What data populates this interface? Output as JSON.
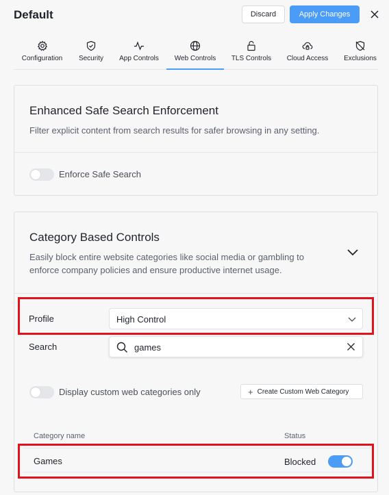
{
  "header": {
    "title": "Default",
    "discard_label": "Discard",
    "apply_label": "Apply Changes"
  },
  "tabs": [
    {
      "label": "Configuration",
      "icon": "gear-icon"
    },
    {
      "label": "Security",
      "icon": "shield-icon"
    },
    {
      "label": "App Controls",
      "icon": "activity-icon"
    },
    {
      "label": "Web Controls",
      "icon": "globe-icon",
      "active": true
    },
    {
      "label": "TLS Controls",
      "icon": "lock-icon"
    },
    {
      "label": "Cloud Access",
      "icon": "cloud-lock-icon"
    },
    {
      "label": "Exclusions",
      "icon": "shield-off-icon"
    }
  ],
  "safe_search": {
    "title": "Enhanced Safe Search Enforcement",
    "description": "Filter explicit content from search results for safer browsing in any setting.",
    "toggle_label": "Enforce Safe Search",
    "enabled": false
  },
  "category": {
    "title": "Category Based Controls",
    "description_line1": "Easily block entire website categories like social media or gambling to",
    "description_line2": "enforce company policies and ensure productive internet usage.",
    "profile_label": "Profile",
    "profile_value": "High Control",
    "search_label": "Search",
    "search_value": "games",
    "custom_toggle_label": "Display custom web categories only",
    "custom_enabled": false,
    "create_button_label": "Create Custom Web Category",
    "columns": {
      "name": "Category name",
      "status": "Status"
    },
    "rows": [
      {
        "name": "Games",
        "status": "Blocked",
        "enabled": true
      }
    ]
  },
  "colors": {
    "accent": "#4a9cf7",
    "highlight": "#e0121b"
  }
}
